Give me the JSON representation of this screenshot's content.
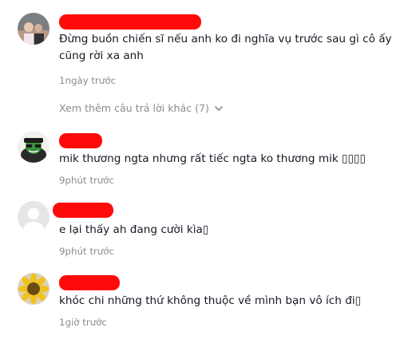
{
  "comments": [
    {
      "text": "Đừng buồn chiến sĩ nếu anh ko đi nghĩa vụ trước sau gì cô ấy cũng rời xa anh",
      "time": "1ngày trước"
    },
    {
      "text": "mik thương ngta nhưng rất tiếc ngta ko thương mik ▯▯▯▯",
      "time": "9phút trước"
    },
    {
      "text": "e lại thấy ah đang cười kìa▯",
      "time": "9phút trước"
    },
    {
      "text": "khóc chi những thứ không thuộc về mình bạn vô ích đi▯",
      "time": "1giờ trước"
    }
  ],
  "view_more": {
    "label": "Xem thêm câu trả lời khác (7)",
    "icon": "chevron-down-icon"
  },
  "colors": {
    "redaction": "#ff0a0a",
    "meta_text": "#8a8b91",
    "body_text": "#161823"
  }
}
